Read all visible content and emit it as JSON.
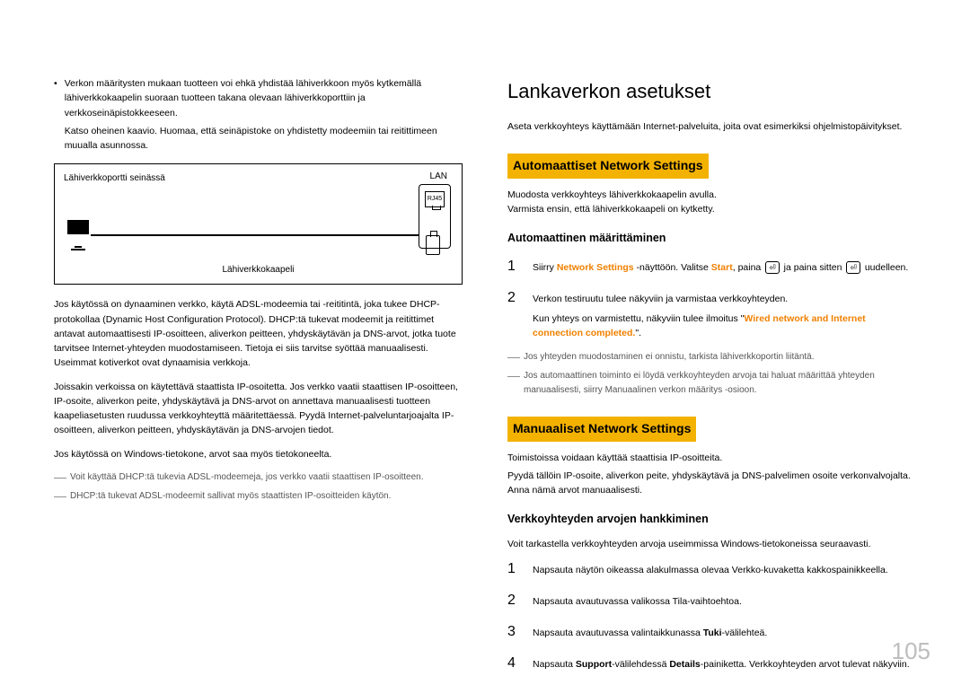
{
  "page_number": "105",
  "left": {
    "bullet1_lead": "•",
    "bullet1": "Verkon määritysten mukaan tuotteen voi ehkä yhdistää lähiverkkoon myös kytkemällä lähiverkkokaapelin suoraan tuotteen takana olevaan lähiverkkoporttiin ja verkkoseinäpistokkeeseen.",
    "bullet1b": "Katso oheinen kaavio. Huomaa, että seinäpistoke on yhdistetty modeemiin tai reitittimeen muualla asunnossa.",
    "diagram": {
      "port_label": "Lähiverkkoportti seinässä",
      "lan": "LAN",
      "rj45": "RJ45",
      "cable": "Lähiverkkokaapeli"
    },
    "p1": "Jos käytössä on dynaaminen verkko, käytä ADSL-modeemia tai -reititintä, joka tukee DHCP-protokollaa (Dynamic Host Configuration Protocol). DHCP:tä tukevat modeemit ja reitittimet antavat automaattisesti IP-osoitteen, aliverkon peitteen, yhdyskäytävän ja DNS-arvot, jotka tuote tarvitsee Internet-yhteyden muodostamiseen. Tietoja ei siis tarvitse syöttää manuaalisesti. Useimmat kotiverkot ovat dynaamisia verkkoja.",
    "p2": "Joissakin verkoissa on käytettävä staattista IP-osoitetta. Jos verkko vaatii staattisen IP-osoitteen, IP-osoite, aliverkon peite, yhdyskäytävä ja DNS-arvot on annettava manuaalisesti tuotteen kaapeliasetusten ruudussa verkkoyhteyttä määritettäessä. Pyydä Internet-palveluntarjoajalta IP-osoitteen, aliverkon peitteen, yhdyskäytävän ja DNS-arvojen tiedot.",
    "p3": "Jos käytössä on Windows-tietokone, arvot saa myös tietokoneelta.",
    "dash1": "Voit käyttää DHCP:tä tukevia ADSL-modeemeja, jos verkko vaatii staattisen IP-osoitteen.",
    "dash2": "DHCP:tä tukevat ADSL-modeemit sallivat myös staattisten IP-osoitteiden käytön."
  },
  "right": {
    "h1": "Lankaverkon asetukset",
    "intro": "Aseta verkkoyhteys käyttämään Internet-palveluita, joita ovat esimerkiksi ohjelmistopäivitykset.",
    "auto_h2": "Automaattiset Network Settings",
    "auto_p1": "Muodosta verkkoyhteys lähiverkkokaapelin avulla.",
    "auto_p2": "Varmista ensin, että lähiverkkokaapeli on kytketty.",
    "auto_h3": "Automaattinen määrittäminen",
    "step1_pre": "Siirry ",
    "step1_ns": "Network Settings",
    "step1_mid": " -näyttöön. Valitse ",
    "step1_start": "Start",
    "step1_mid2": ", paina ",
    "step1_key": "⏎",
    "step1_mid3": " ja paina sitten ",
    "step1_end": " uudelleen.",
    "step2": "Verkon testiruutu tulee näkyviin ja varmistaa verkkoyhteyden.",
    "step2b_pre": "Kun yhteys on varmistettu, näkyviin tulee ilmoitus \"",
    "step2b_quote": "Wired network and Internet connection completed.",
    "step2b_post": "\".",
    "dash_a": "Jos yhteyden muodostaminen ei onnistu, tarkista lähiverkkoportin liitäntä.",
    "dash_b": "Jos automaattinen toiminto ei löydä verkkoyhteyden arvoja tai haluat määrittää yhteyden manuaalisesti, siirry Manuaalinen verkon määritys -osioon.",
    "man_h2": "Manuaaliset Network Settings",
    "man_p1": "Toimistoissa voidaan käyttää staattisia IP-osoitteita.",
    "man_p2": "Pyydä tällöin IP-osoite, aliverkon peite, yhdyskäytävä ja DNS-palvelimen osoite verkonvalvojalta. Anna nämä arvot manuaalisesti.",
    "man_h3": "Verkkoyhteyden arvojen hankkiminen",
    "man_lead": "Voit tarkastella verkkoyhteyden arvoja useimmissa Windows-tietokoneissa seuraavasti.",
    "mstep1": "Napsauta näytön oikeassa alakulmassa olevaa Verkko-kuvaketta kakkospainikkeella.",
    "mstep2": "Napsauta avautuvassa valikossa Tila-vaihtoehtoa.",
    "mstep3_pre": "Napsauta avautuvassa valintaikkunassa ",
    "mstep3_b": "Tuki",
    "mstep3_post": "-välilehteä.",
    "mstep4_pre": "Napsauta ",
    "mstep4_b1": "Support",
    "mstep4_mid": "-välilehdessä ",
    "mstep4_b2": "Details",
    "mstep4_post": "-painiketta. Verkkoyhteyden arvot tulevat näkyviin."
  }
}
